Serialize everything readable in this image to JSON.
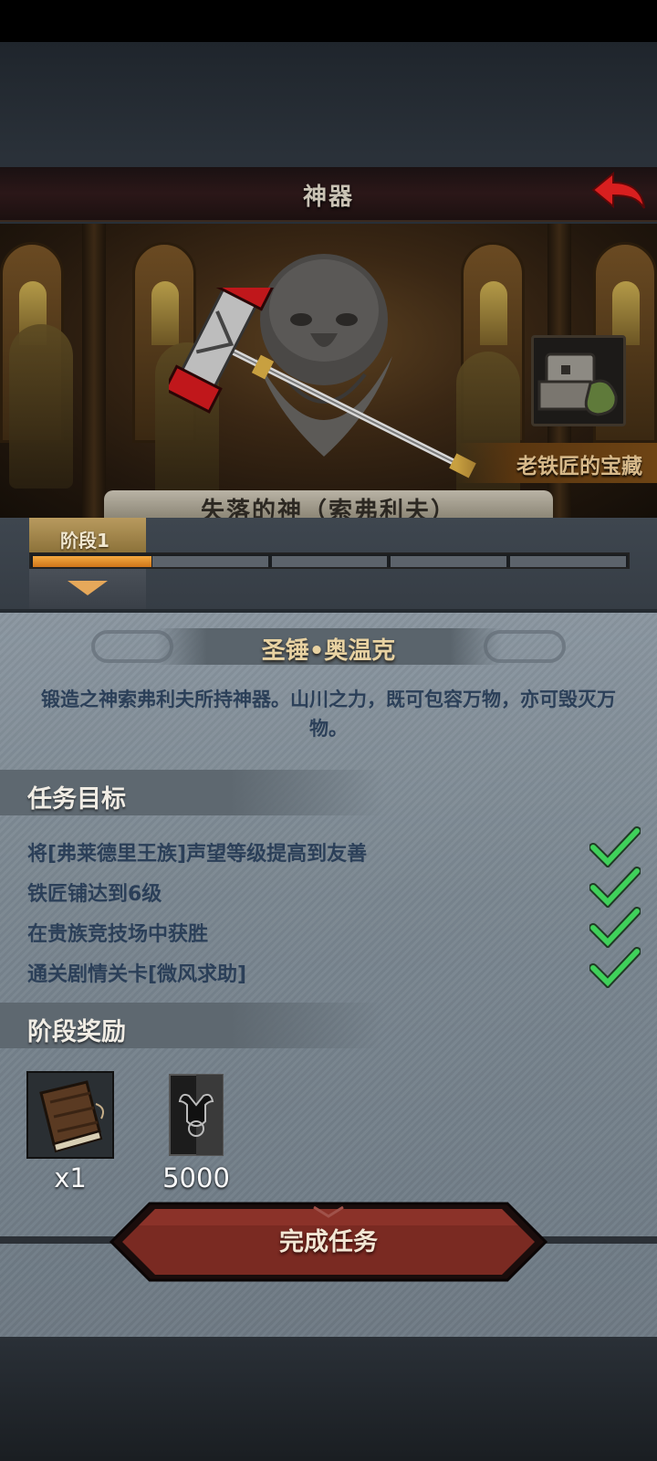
{
  "header": {
    "title": "神器"
  },
  "hero": {
    "treasure_label": "老铁匠的宝藏",
    "god_name": "失落的神（索弗利夫）"
  },
  "stage": {
    "tab_label": "阶段1",
    "progress_fraction": 0.2,
    "segments": 5
  },
  "artifact": {
    "name": "圣锤•奥温克",
    "description": "锻造之神索弗利夫所持神器。山川之力，既可包容万物，亦可毁灭万物。"
  },
  "tasks": {
    "heading": "任务目标",
    "items": [
      {
        "text": "将[弗莱德里王族]声望等级提高到友善",
        "done": true
      },
      {
        "text": "铁匠铺达到6级",
        "done": true
      },
      {
        "text": "在贵族竞技场中获胜",
        "done": true
      },
      {
        "text": "通关剧情关卡[微风求助]",
        "done": true
      }
    ]
  },
  "rewards": {
    "heading": "阶段奖励",
    "items": [
      {
        "icon": "book-icon",
        "count": "x1"
      },
      {
        "icon": "bull-emblem-icon",
        "count": "5000"
      }
    ]
  },
  "action": {
    "complete_label": "完成任务"
  },
  "colors": {
    "accent_gold": "#e8d2a2",
    "check_green": "#3fd15a",
    "button_red": "#7a2a22",
    "text_blue": "#2b3f58"
  }
}
